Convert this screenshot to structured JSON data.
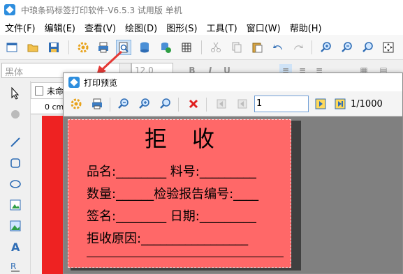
{
  "app": {
    "title": "中琅条码标签打印软件-V6.5.3 试用版 单机"
  },
  "menu": [
    {
      "label": "文件(F)"
    },
    {
      "label": "编辑(E)"
    },
    {
      "label": "查看(V)"
    },
    {
      "label": "绘图(D)"
    },
    {
      "label": "图形(S)"
    },
    {
      "label": "工具(T)"
    },
    {
      "label": "窗口(W)"
    },
    {
      "label": "帮助(H)"
    }
  ],
  "format_bar": {
    "font": "黑体",
    "size": "12.0"
  },
  "document": {
    "tab_label": "未命",
    "ruler_unit": "0 cm"
  },
  "preview": {
    "title": "打印预览",
    "page_value": "1",
    "page_count": "1/1000"
  },
  "label": {
    "title": "拒　收",
    "rows": [
      "品名:________ 料号:_________",
      "数量:______检验报告编号:____",
      "签名:________ 日期:_________",
      "拒收原因:_________________"
    ]
  },
  "colors": {
    "label_bg": "#ff6868",
    "preview_bg": "#808080",
    "accent": "#2e8ede"
  }
}
